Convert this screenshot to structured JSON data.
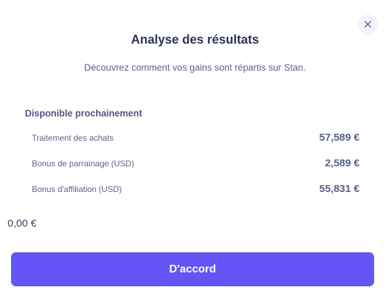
{
  "dialog": {
    "title": "Analyse des résultats",
    "subtitle": "Découvrez comment vos gains sont répartis sur Stan.",
    "close_icon": "close-icon"
  },
  "section": {
    "title": "Disponible prochainement",
    "rows": [
      {
        "label": "Traitement des achats",
        "value": "57,589 €"
      },
      {
        "label": "Bonus de parrainage (USD)",
        "value": "2,589 €"
      },
      {
        "label": "Bonus d'affiliation (USD)",
        "value": "55,831 €"
      }
    ]
  },
  "total": "0,00 €",
  "confirm_button": {
    "label": "D'accord"
  },
  "colors": {
    "accent": "#6355f6",
    "title": "#2e3456",
    "muted": "#5d6386"
  }
}
